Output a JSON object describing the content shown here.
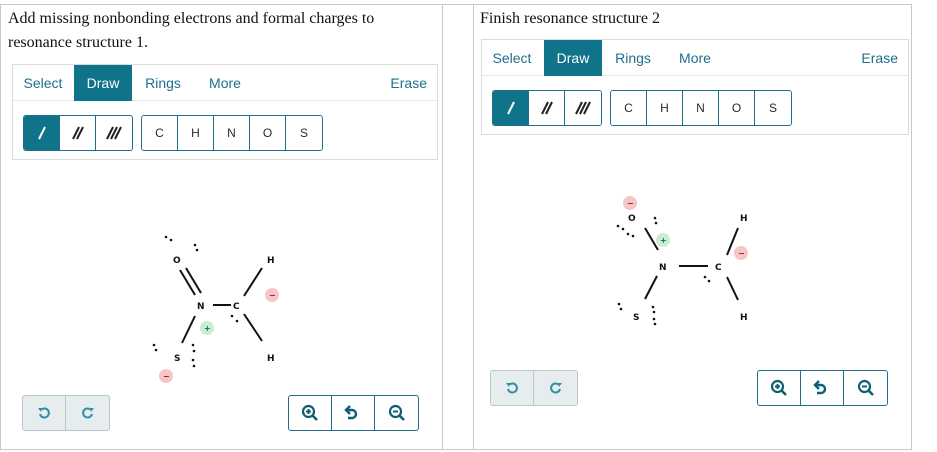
{
  "panels": [
    {
      "prompt": "Add missing nonbonding electrons and formal charges to resonance structure 1.",
      "toolbar": {
        "tabs": [
          "Select",
          "Draw",
          "Rings",
          "More"
        ],
        "erase": "Erase"
      },
      "atoms": [
        "C",
        "H",
        "N",
        "O",
        "S"
      ],
      "molecule": {
        "O": "O",
        "N": "N",
        "C": "C",
        "S": "S",
        "H_top": "H",
        "H_bottom": "H",
        "charge_plus": "+",
        "charge_minus_c": "−",
        "charge_minus_s": "−"
      }
    },
    {
      "prompt": "Finish resonance structure 2",
      "toolbar": {
        "tabs": [
          "Select",
          "Draw",
          "Rings",
          "More"
        ],
        "erase": "Erase"
      },
      "atoms": [
        "C",
        "H",
        "N",
        "O",
        "S"
      ],
      "molecule": {
        "O": "O",
        "N": "N",
        "C": "C",
        "S": "S",
        "H_top": "H",
        "H_bottom": "H",
        "charge_plus": "+",
        "charge_minus_o": "−",
        "charge_minus_c": "−"
      }
    }
  ],
  "colors": {
    "accent": "#0f7389",
    "tab_text": "#1e6f8c",
    "plus_charge_bg": "#c9ecd3",
    "minus_charge_bg": "#f6c6c6"
  },
  "icons": {
    "bond_tools": [
      "single-bond-icon",
      "double-bond-icon",
      "triple-bond-icon"
    ],
    "history": [
      "undo-icon",
      "redo-icon"
    ],
    "zoom": [
      "zoom-in-icon",
      "reset-zoom-icon",
      "zoom-out-icon"
    ]
  }
}
